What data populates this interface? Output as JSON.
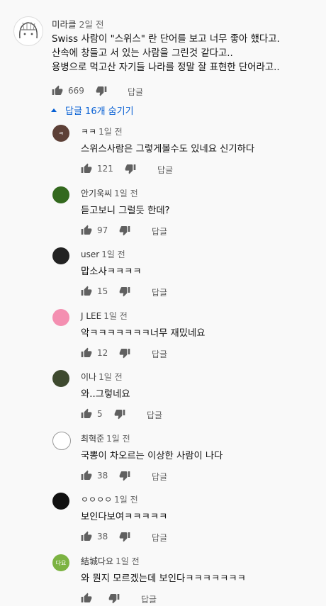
{
  "top_comment": {
    "author": "미라클",
    "time": "2일 전",
    "lines": [
      "Swiss 사람이 \"스위스\" 란 단어를 보고 너무 좋아 했다고.",
      "산속에 창들고 서 있는 사람을 그린것 같다고..",
      "용병으로 먹고산 자기들 나라를 정말 잘 표현한 단어라고.."
    ],
    "likes": "669",
    "reply_label": "답글"
  },
  "replies_toggle": "답글 16개 숨기기",
  "replies": [
    {
      "author": "ㅋㅋ",
      "time": "1일 전",
      "text": "스위스사람은 그렇게볼수도 있네요 신기하다",
      "likes": "121",
      "reply_label": "답글",
      "avatar_color": "#5d4037",
      "avatar_letter": "ㅋ"
    },
    {
      "author": "안기욱씨",
      "time": "1일 전",
      "text": "듣고보니 그럴듯 한데?",
      "likes": "97",
      "reply_label": "답글",
      "avatar_color": "#33691e",
      "avatar_letter": ""
    },
    {
      "author": "user",
      "time": "1일 전",
      "text": "맙소사ㅋㅋㅋㅋ",
      "likes": "15",
      "reply_label": "답글",
      "avatar_color": "#222222",
      "avatar_letter": ""
    },
    {
      "author": "J LEE",
      "time": "1일 전",
      "text": "악ㅋㅋㅋㅋㅋㅋㅋ너무 재밌네요",
      "likes": "12",
      "reply_label": "답글",
      "avatar_color": "#f48fb1",
      "avatar_letter": ""
    },
    {
      "author": "이나",
      "time": "1일 전",
      "text": "와..그렇네요",
      "likes": "5",
      "reply_label": "답글",
      "avatar_color": "#3e4a2f",
      "avatar_letter": ""
    },
    {
      "author": "최혁준",
      "time": "1일 전",
      "text": "국뽕이 차오르는 이상한 사람이 나다",
      "likes": "38",
      "reply_label": "답글",
      "avatar_color": "#ffffff",
      "avatar_letter": ""
    },
    {
      "author": "ㅇㅇㅇㅇ",
      "time": "1일 전",
      "text": "보인다보여ㅋㅋㅋㅋㅋ",
      "likes": "38",
      "reply_label": "답글",
      "avatar_color": "#111111",
      "avatar_letter": ""
    },
    {
      "author": "結城다요",
      "time": "1일 전",
      "text": "와 뭔지 모르겠는데 보인다ㅋㅋㅋㅋㅋㅋㅋ",
      "likes": "",
      "reply_label": "답글",
      "avatar_color": "#7cb342",
      "avatar_letter": "다요"
    }
  ]
}
